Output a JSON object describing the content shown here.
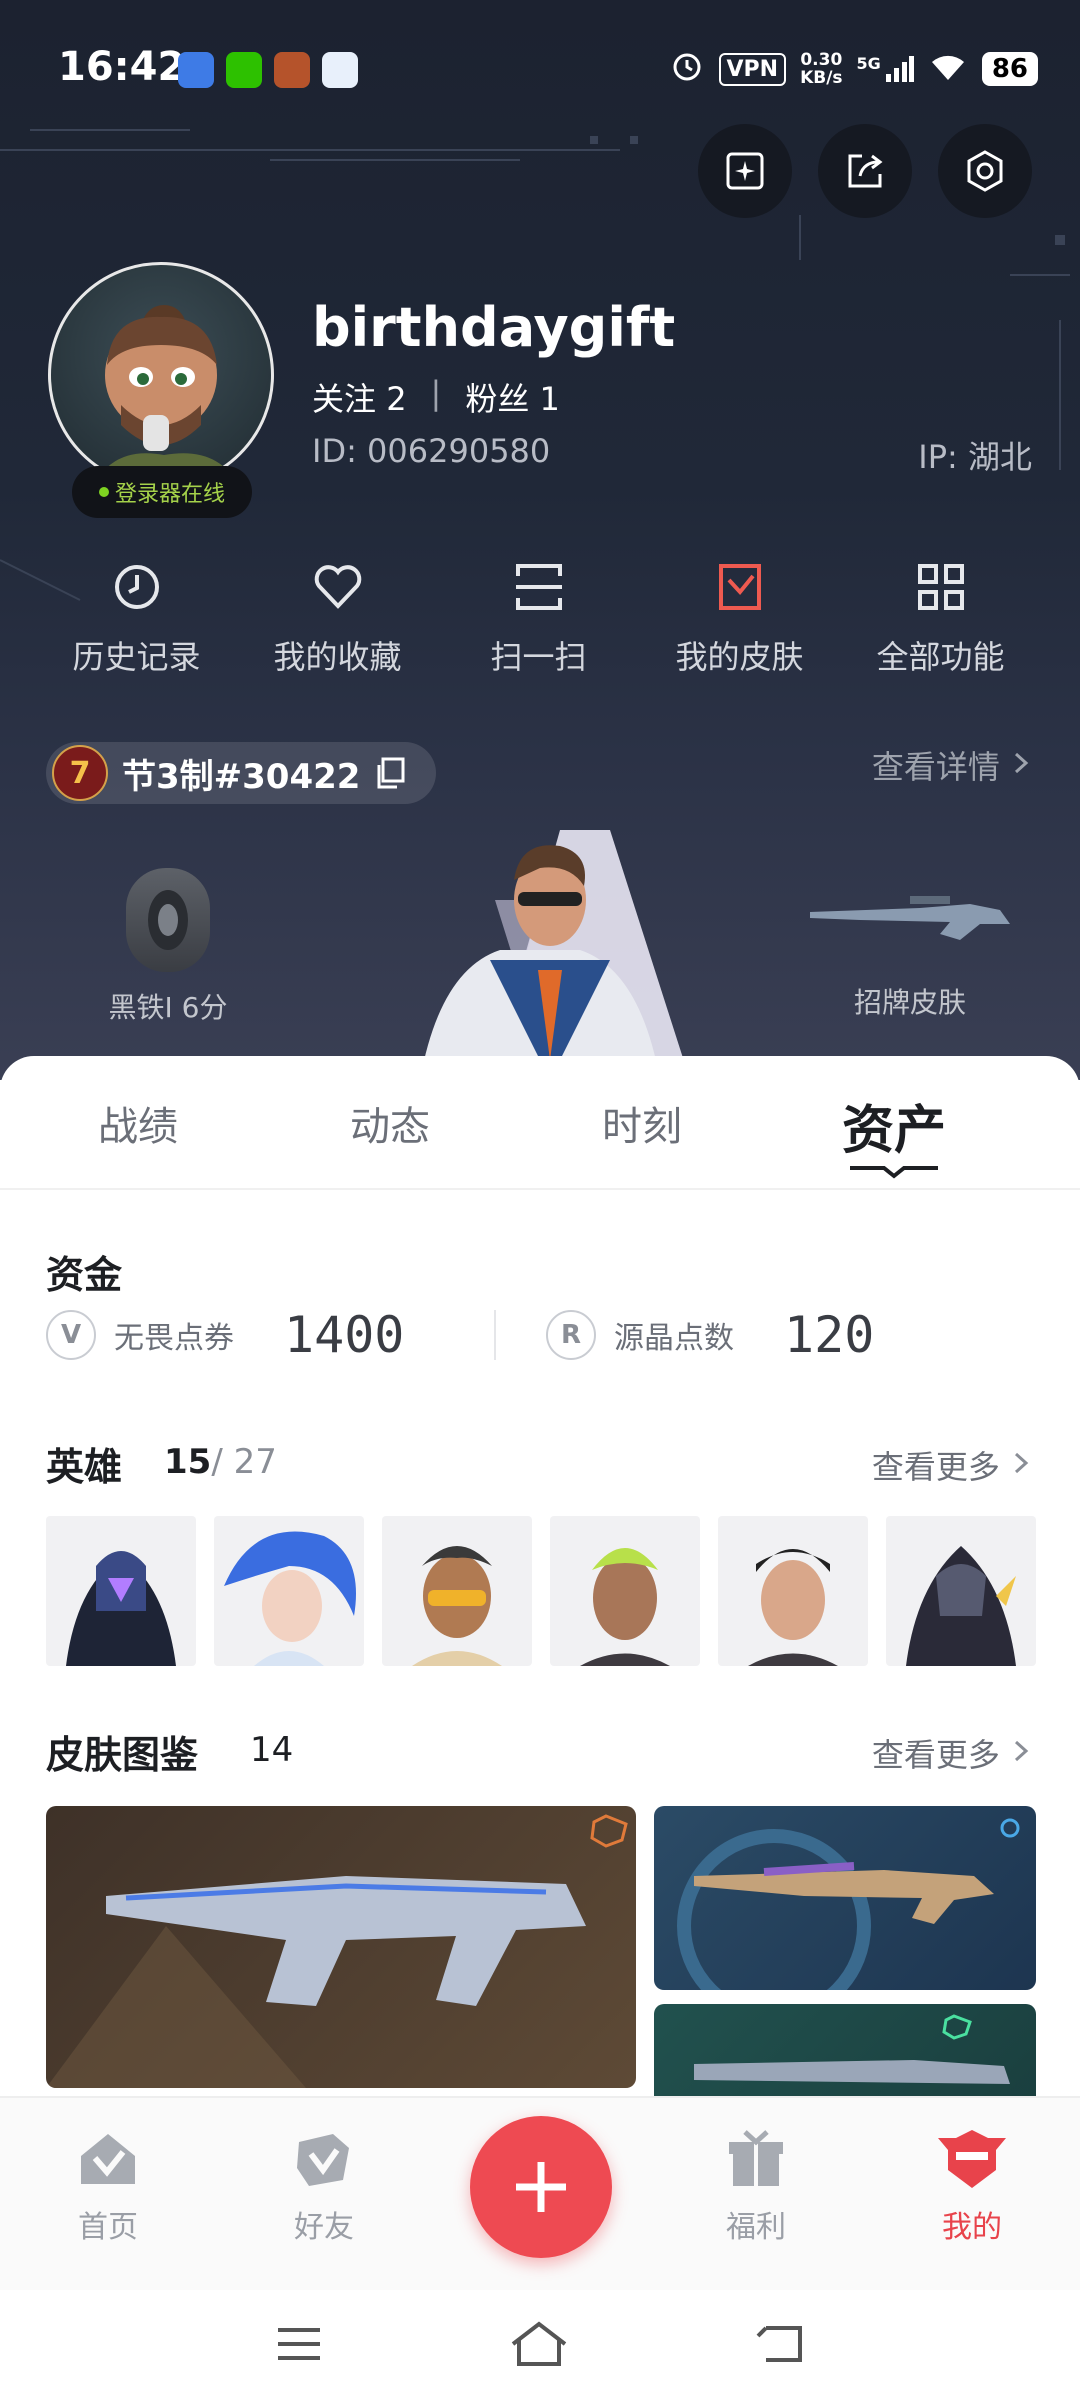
{
  "status_bar": {
    "time": "16:42",
    "vpn": "VPN",
    "net_speed_value": "0.30",
    "net_speed_unit": "KB/s",
    "signal": "5G",
    "battery": "86"
  },
  "profile": {
    "username": "birthdaygift",
    "follow_label": "关注",
    "follow_count": "2",
    "fans_label": "粉丝",
    "fans_count": "1",
    "separator": "|",
    "user_id": "ID:  006290580",
    "ip": "IP:  湖北",
    "online_status": "登录器在线"
  },
  "quick_actions": [
    {
      "label": "历史记录",
      "icon": "history-icon"
    },
    {
      "label": "我的收藏",
      "icon": "heart-icon"
    },
    {
      "label": "扫一扫",
      "icon": "scan-icon"
    },
    {
      "label": "我的皮肤",
      "icon": "skin-icon"
    },
    {
      "label": "全部功能",
      "icon": "grid-icon"
    }
  ],
  "game_account": {
    "name": "节3制#30422",
    "detail_link": "查看详情",
    "rank_label": "黑铁Ⅰ 6分",
    "signature_skin_label": "招牌皮肤"
  },
  "tabs": [
    {
      "label": "战绩",
      "active": false
    },
    {
      "label": "动态",
      "active": false
    },
    {
      "label": "时刻",
      "active": false
    },
    {
      "label": "资产",
      "active": true
    }
  ],
  "funds": {
    "title": "资金",
    "vp_label": "无畏点券",
    "vp_value": "1400",
    "rp_label": "源晶点数",
    "rp_value": "120"
  },
  "agents": {
    "title": "英雄",
    "owned": "15",
    "total": "/ 27",
    "more": "查看更多"
  },
  "skins": {
    "title": "皮肤图鉴",
    "count": "14",
    "more": "查看更多"
  },
  "bottom_nav": [
    {
      "label": "首页",
      "icon": "home-icon",
      "active": false
    },
    {
      "label": "好友",
      "icon": "friends-icon",
      "active": false
    },
    {
      "label": "福利",
      "icon": "gift-icon",
      "active": false
    },
    {
      "label": "我的",
      "icon": "profile-icon",
      "active": true
    }
  ],
  "colors": {
    "accent": "#ee4a52",
    "hero_bg": "#1c2230",
    "online_green": "#7ed321"
  }
}
